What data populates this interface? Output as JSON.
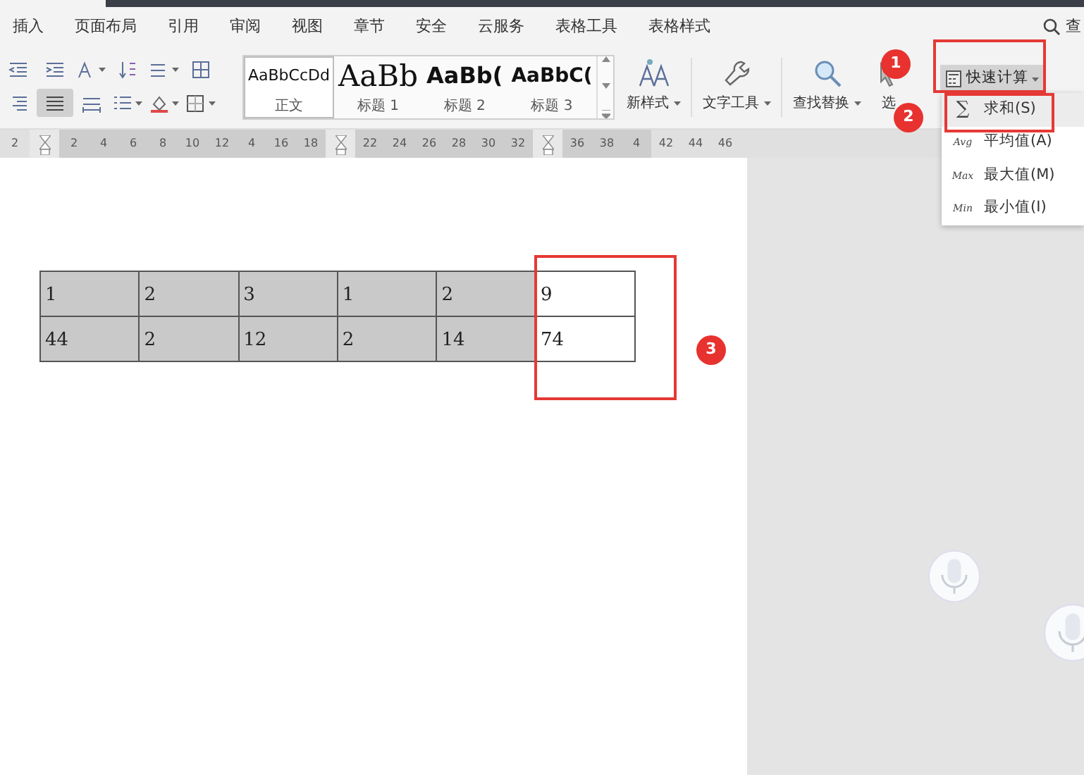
{
  "menu_tabs": [
    {
      "label": "插入"
    },
    {
      "label": "页面布局"
    },
    {
      "label": "引用"
    },
    {
      "label": "审阅"
    },
    {
      "label": "视图"
    },
    {
      "label": "章节"
    },
    {
      "label": "安全"
    },
    {
      "label": "云服务"
    },
    {
      "label": "表格工具"
    },
    {
      "label": "表格样式"
    }
  ],
  "search": {
    "label": "查"
  },
  "format_tools": [
    [
      {
        "kind": "outdent",
        "selected": false
      },
      {
        "kind": "indent",
        "selected": false
      },
      {
        "kind": "font-case",
        "selected": false
      },
      {
        "kind": "sort",
        "selected": false
      },
      {
        "kind": "spacing",
        "selected": false
      },
      {
        "kind": "grid",
        "selected": false
      }
    ],
    [
      {
        "kind": "align-right",
        "selected": false
      },
      {
        "kind": "justify",
        "selected": true
      },
      {
        "kind": "distribute",
        "selected": false
      },
      {
        "kind": "list",
        "selected": false
      },
      {
        "kind": "fill",
        "selected": false
      },
      {
        "kind": "border",
        "selected": false
      }
    ]
  ],
  "styles": [
    {
      "preview": "AaBbCcDd",
      "label": "正文",
      "kind": "body",
      "selected": true
    },
    {
      "preview": "AaBb",
      "label": "标题 1",
      "kind": "heading1",
      "selected": false
    },
    {
      "preview": "AaBb(",
      "label": "标题 2",
      "kind": "heading2",
      "selected": false
    },
    {
      "preview": "AaBbC(",
      "label": "标题 3",
      "kind": "heading3",
      "selected": false
    }
  ],
  "commands": [
    {
      "kind": "new-style",
      "label": "新样式",
      "dropdown": true
    },
    {
      "kind": "text-tools",
      "label": "文字工具",
      "dropdown": true
    },
    {
      "kind": "find",
      "label": "查找替换",
      "dropdown": true
    },
    {
      "kind": "select",
      "label": "选",
      "dropdown": false
    }
  ],
  "quick_calc": {
    "label": "快速计算",
    "expanded": true
  },
  "quick_calc_menu": [
    {
      "icon": "∑",
      "label": "求和(S)",
      "selected": true
    },
    {
      "icon": "Avg",
      "label": "平均值(A)",
      "selected": false
    },
    {
      "icon": "Max",
      "label": "最大值(M)",
      "selected": false
    },
    {
      "icon": "Min",
      "label": "最小值(I)",
      "selected": false
    }
  ],
  "ruler": [
    {
      "kind": "number",
      "text": "2"
    },
    {
      "kind": "marker"
    },
    {
      "kind": "number",
      "text": "2"
    },
    {
      "kind": "number",
      "text": "4"
    },
    {
      "kind": "number",
      "text": "6"
    },
    {
      "kind": "number",
      "text": "8"
    },
    {
      "kind": "number",
      "text": "10"
    },
    {
      "kind": "number",
      "text": "12"
    },
    {
      "kind": "number",
      "text": "4"
    },
    {
      "kind": "number",
      "text": "16"
    },
    {
      "kind": "number",
      "text": "18"
    },
    {
      "kind": "marker"
    },
    {
      "kind": "number",
      "text": "22"
    },
    {
      "kind": "number",
      "text": "24"
    },
    {
      "kind": "number",
      "text": "26"
    },
    {
      "kind": "number",
      "text": "28"
    },
    {
      "kind": "number",
      "text": "30"
    },
    {
      "kind": "number",
      "text": "32"
    },
    {
      "kind": "marker"
    },
    {
      "kind": "number",
      "text": "36"
    },
    {
      "kind": "number",
      "text": "38"
    },
    {
      "kind": "number",
      "text": "4"
    },
    {
      "kind": "number",
      "text": "42"
    },
    {
      "kind": "number",
      "text": "44"
    },
    {
      "kind": "number",
      "text": "46"
    }
  ],
  "table": {
    "rows": [
      [
        {
          "text": "1",
          "selected": true
        },
        {
          "text": "2",
          "selected": true
        },
        {
          "text": "3",
          "selected": true
        },
        {
          "text": "1",
          "selected": true
        },
        {
          "text": "2",
          "selected": true
        },
        {
          "text": "9",
          "selected": false
        }
      ],
      [
        {
          "text": "44",
          "selected": true
        },
        {
          "text": "2",
          "selected": true
        },
        {
          "text": "12",
          "selected": true
        },
        {
          "text": "2",
          "selected": true
        },
        {
          "text": "14",
          "selected": true
        },
        {
          "text": "74",
          "selected": false
        }
      ]
    ]
  },
  "annotations": [
    {
      "number": "1"
    },
    {
      "number": "2"
    },
    {
      "number": "3"
    }
  ]
}
